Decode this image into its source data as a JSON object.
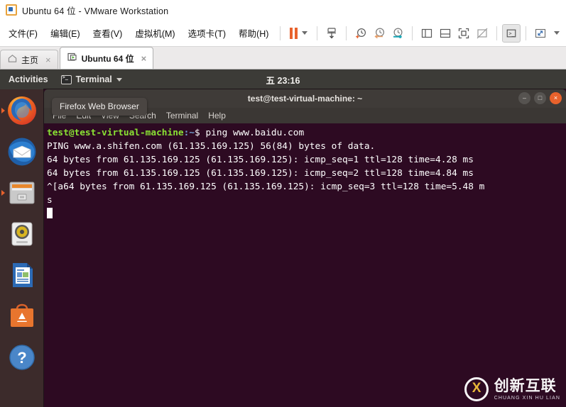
{
  "vmware": {
    "window_title": "Ubuntu 64 位 - VMware Workstation",
    "menus": [
      {
        "label": "文件(F)",
        "name": "menu-file"
      },
      {
        "label": "编辑(E)",
        "name": "menu-edit"
      },
      {
        "label": "查看(V)",
        "name": "menu-view"
      },
      {
        "label": "虚拟机(M)",
        "name": "menu-vm"
      },
      {
        "label": "选项卡(T)",
        "name": "menu-tabs"
      },
      {
        "label": "帮助(H)",
        "name": "menu-help"
      }
    ],
    "toolbar": {
      "pause": "pause-icon",
      "pause_dropdown": "chevron-down-icon",
      "send_keys": "send-ctrl-alt-delete-icon",
      "snapshot_take": "take-snapshot-icon",
      "snapshot_revert": "revert-snapshot-icon",
      "snapshot_manage": "manage-snapshots-icon",
      "view_sidebar": "show-library-icon",
      "view_console": "show-console-view-icon",
      "view_fullscreen": "enter-fullscreen-icon",
      "view_unity": "unity-mode-icon",
      "console_active": "console-view-icon",
      "stretch": "stretch-guest-icon",
      "stretch_dropdown": "chevron-down-icon"
    },
    "tabs": [
      {
        "label": "主页",
        "icon": "home-icon",
        "active": false,
        "close": "×"
      },
      {
        "label": "Ubuntu 64 位",
        "icon": "vm-power-icon",
        "active": true,
        "close": "×"
      }
    ]
  },
  "ubuntu": {
    "topbar": {
      "activities": "Activities",
      "app_name": "Terminal",
      "app_icon": "terminal-icon",
      "app_caret": "chevron-down-icon",
      "clock": "五 23:16"
    },
    "dock": [
      {
        "name": "firefox",
        "label": "Firefox Web Browser",
        "running": true,
        "focused": false
      },
      {
        "name": "thunderbird",
        "label": "Thunderbird Mail",
        "running": false,
        "focused": false
      },
      {
        "name": "files",
        "label": "Files",
        "running": true,
        "focused": false
      },
      {
        "name": "rhythmbox",
        "label": "Rhythmbox",
        "running": false,
        "focused": false
      },
      {
        "name": "libreoffice-writer",
        "label": "LibreOffice Writer",
        "running": false,
        "focused": false
      },
      {
        "name": "ubuntu-software",
        "label": "Ubuntu Software",
        "running": false,
        "focused": false
      },
      {
        "name": "help",
        "label": "Help",
        "running": false,
        "focused": false
      }
    ],
    "tooltip": "Firefox Web Browser"
  },
  "terminal": {
    "title": "test@test-virtual-machine: ~",
    "window_controls": {
      "minimize": "–",
      "maximize": "□",
      "close": "×"
    },
    "menus": [
      {
        "label": "File",
        "name": "terminal-menu-file"
      },
      {
        "label": "Edit",
        "name": "terminal-menu-edit"
      },
      {
        "label": "View",
        "name": "terminal-menu-view"
      },
      {
        "label": "Search",
        "name": "terminal-menu-search"
      },
      {
        "label": "Terminal",
        "name": "terminal-menu-terminal"
      },
      {
        "label": "Help",
        "name": "terminal-menu-help"
      }
    ],
    "prompt": {
      "user_host": "test@test-virtual-machine",
      "path": ":~",
      "symbol": "$ ",
      "command": "ping www.baidu.com"
    },
    "output": [
      "PING www.a.shifen.com (61.135.169.125) 56(84) bytes of data.",
      "64 bytes from 61.135.169.125 (61.135.169.125): icmp_seq=1 ttl=128 time=4.28 ms",
      "64 bytes from 61.135.169.125 (61.135.169.125): icmp_seq=2 ttl=128 time=4.84 ms",
      "^[a64 bytes from 61.135.169.125 (61.135.169.125): icmp_seq=3 ttl=128 time=5.48 m",
      "s"
    ]
  },
  "watermark": {
    "cn": "创新互联",
    "en": "CHUANG XIN HU LIAN",
    "logo": "cx-circle-logo"
  },
  "colors": {
    "accent_orange": "#e8622c",
    "terminal_bg": "#2d0a22",
    "dock_bg": "#3c2b2b",
    "topbar_bg": "#3c3b37",
    "prompt_green": "#8ae234",
    "prompt_blue": "#729fcf"
  }
}
